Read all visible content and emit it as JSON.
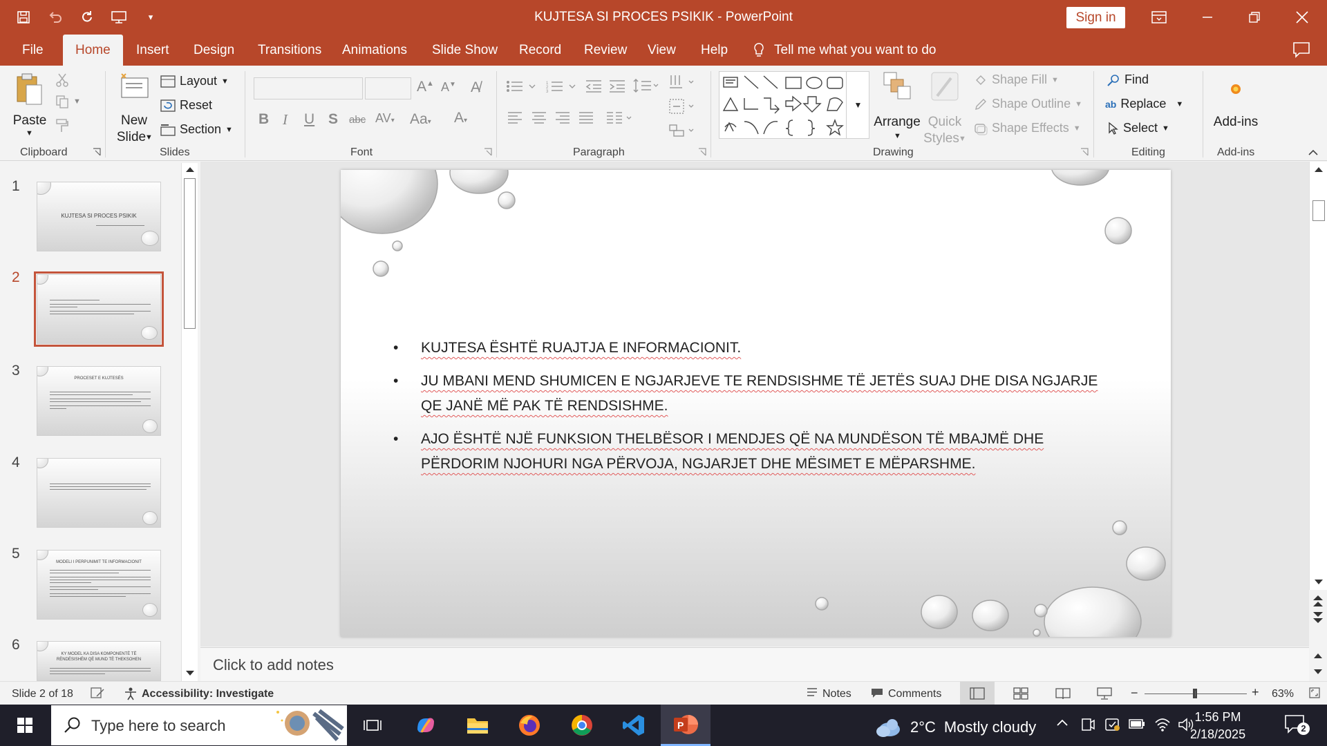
{
  "window": {
    "title": "KUJTESA SI PROCES PSIKIK  -  PowerPoint",
    "sign_in": "Sign in"
  },
  "tabs": [
    "File",
    "Home",
    "Insert",
    "Design",
    "Transitions",
    "Animations",
    "Slide Show",
    "Record",
    "Review",
    "View",
    "Help"
  ],
  "tell_me": "Tell me what you want to do",
  "ribbon": {
    "clipboard": {
      "label": "Clipboard",
      "paste": "Paste"
    },
    "slides": {
      "label": "Slides",
      "new_slide_1": "New",
      "new_slide_2": "Slide",
      "layout": "Layout",
      "reset": "Reset",
      "section": "Section"
    },
    "font": {
      "label": "Font"
    },
    "paragraph": {
      "label": "Paragraph"
    },
    "drawing": {
      "label": "Drawing",
      "arrange": "Arrange",
      "quick_styles_1": "Quick",
      "quick_styles_2": "Styles",
      "shape_fill": "Shape Fill",
      "shape_outline": "Shape Outline",
      "shape_effects": "Shape Effects"
    },
    "editing": {
      "label": "Editing",
      "find": "Find",
      "replace": "Replace",
      "select": "Select"
    },
    "addins": {
      "label": "Add-ins",
      "button": "Add-ins"
    }
  },
  "thumbnails": [
    {
      "number": "1",
      "title": "KUJTESA SI PROCES PSIKIK"
    },
    {
      "number": "2",
      "title": ""
    },
    {
      "number": "3",
      "title": "PROCESET E KUJTESËS"
    },
    {
      "number": "4",
      "title": ""
    },
    {
      "number": "5",
      "title": "MODELI I PERPUNIMIT TE INFORMACIONIT"
    },
    {
      "number": "6",
      "title": "KY MODEL KA DISA KOMPONENTË TË RËNDËSISHËM QË MUND TË THEKSOHEN"
    }
  ],
  "selected_slide": 2,
  "slide": {
    "bullets": [
      "KUJTESA ËSHTË RUAJTJA E INFORMACIONIT.",
      "JU MBANI MEND SHUMICEN E NGJARJEVE TE RENDSISHME TË JETËS SUAJ DHE DISA NGJARJE QE JANË MË PAK TË RENDSISHME.",
      "AJO ËSHTË NJË FUNKSION THELBËSOR I MENDJES QË NA MUNDËSON TË MBAJMË DHE PËRDORIM NJOHURI NGA PËRVOJA, NGJARJET DHE MËSIMET E MËPARSHME."
    ]
  },
  "notes_placeholder": "Click to add notes",
  "status": {
    "slide_count": "Slide 2 of 18",
    "accessibility": "Accessibility: Investigate",
    "notes": "Notes",
    "comments": "Comments",
    "zoom": "63%"
  },
  "taskbar": {
    "search_placeholder": "Type here to search",
    "weather_temp": "2°C",
    "weather_desc": "Mostly cloudy",
    "time": "1:56 PM",
    "date": "2/18/2025",
    "notifications": "2"
  },
  "colors": {
    "accent": "#b7472a",
    "selection": "#c4543b"
  }
}
